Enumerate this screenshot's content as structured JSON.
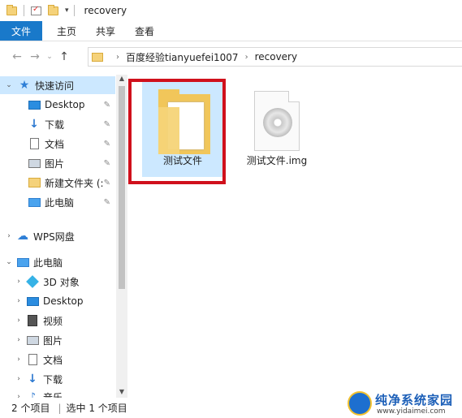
{
  "window": {
    "title": "recovery"
  },
  "ribbon": {
    "tabs": [
      "文件",
      "主页",
      "共享",
      "查看"
    ]
  },
  "address": {
    "crumbs": [
      "百度经验tianyuefei1007",
      "recovery"
    ]
  },
  "sidebar": {
    "quick_access_label": "快速访问",
    "quick_items": [
      {
        "label": "Desktop",
        "icon": "desktop-icon"
      },
      {
        "label": "下载",
        "icon": "download-icon"
      },
      {
        "label": "文档",
        "icon": "document-icon"
      },
      {
        "label": "图片",
        "icon": "pictures-icon"
      },
      {
        "label": "新建文件夹 (:",
        "icon": "folder-icon"
      },
      {
        "label": "此电脑",
        "icon": "computer-icon"
      }
    ],
    "wps_label": "WPS网盘",
    "this_pc_label": "此电脑",
    "pc_items": [
      {
        "label": "3D 对象",
        "icon": "3d-objects-icon"
      },
      {
        "label": "Desktop",
        "icon": "desktop-icon"
      },
      {
        "label": "视频",
        "icon": "video-icon"
      },
      {
        "label": "图片",
        "icon": "pictures-icon"
      },
      {
        "label": "文档",
        "icon": "document-icon"
      },
      {
        "label": "下载",
        "icon": "download-icon"
      },
      {
        "label": "音乐",
        "icon": "music-icon"
      }
    ]
  },
  "files": [
    {
      "name": "测试文件",
      "type": "folder",
      "selected": true
    },
    {
      "name": "测试文件.img",
      "type": "disc-image",
      "selected": false
    }
  ],
  "status": {
    "item_count": "2 个项目",
    "selected": "选中 1 个项目"
  },
  "watermark": {
    "title": "纯净系统家园",
    "url": "www.yidaimei.com"
  },
  "colors": {
    "file_tab": "#1979ca",
    "selection": "#cce8ff",
    "highlight_box": "#d0101c"
  }
}
